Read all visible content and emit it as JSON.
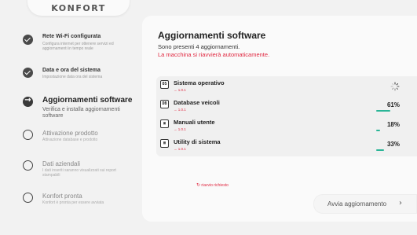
{
  "brand": {
    "logo_text": "KONFORT"
  },
  "steps": [
    {
      "title": "Rete Wi-Fi configurata",
      "desc": "Configura internet per ottenere servizi ed aggiornamenti in tempo reale",
      "state": "done"
    },
    {
      "title": "Data e ora del sistema",
      "desc": "Impostazione data ora del sistema",
      "state": "done"
    },
    {
      "title": "Aggiornamenti software",
      "desc": "Verifica e installa aggiornamenti software",
      "state": "current"
    },
    {
      "title": "Attivazione prodotto",
      "desc": "Attivazione database e prodotto",
      "state": "todo"
    },
    {
      "title": "Dati aziendali",
      "desc": "I dati inseriti saranno visualizzati sui report stampabili",
      "state": "todo"
    },
    {
      "title": "Konfort pronta",
      "desc": "Konfort è pronta per essere avviata",
      "state": "todo"
    }
  ],
  "main": {
    "title": "Aggiornamenti software",
    "subtitle": "Sono presenti 4 aggiornamenti.",
    "warning": "La macchina si riavvierà automaticamente."
  },
  "updates": [
    {
      "icon_text": "OS",
      "icon": "os-icon",
      "name": "Sistema operativo",
      "version": "→ 1.0.1",
      "status": "loading",
      "progress": null,
      "percent_label": ""
    },
    {
      "icon_text": "DB",
      "icon": "database-icon",
      "name": "Database veicoli",
      "version": "→ 1.0.1",
      "status": "progress",
      "progress": 0.61,
      "percent_label": "61%"
    },
    {
      "icon_text": "▣",
      "icon": "manual-icon",
      "name": "Manuali utente",
      "version": "→ 1.0.1",
      "status": "progress",
      "progress": 0.18,
      "percent_label": "18%"
    },
    {
      "icon_text": "▦",
      "icon": "toolbox-icon",
      "name": "Utility di sistema",
      "version": "→ 1.0.1",
      "status": "progress",
      "progress": 0.33,
      "percent_label": "33%"
    }
  ],
  "actions": {
    "update_label": "Avvia aggiornamento",
    "update_arrow": "›",
    "restart_note": "riavvio richiesto"
  },
  "colors": {
    "accent": "#2bb597",
    "warning": "#e0263f"
  }
}
